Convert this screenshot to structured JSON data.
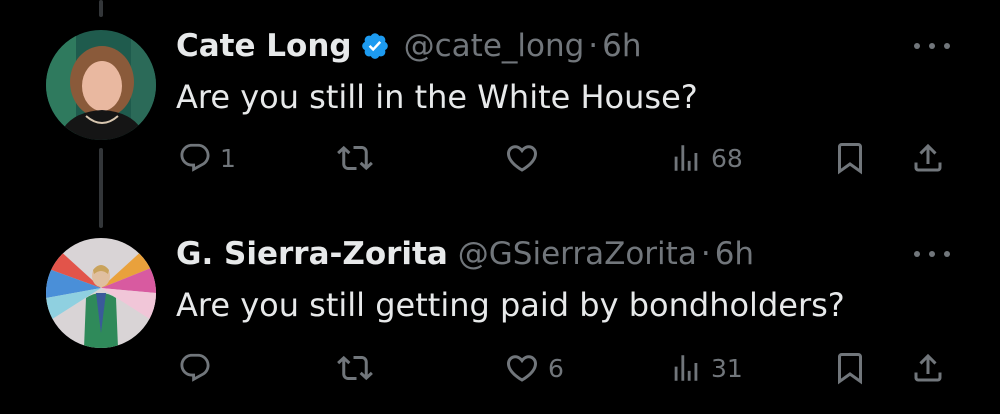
{
  "tweets": [
    {
      "name": "Cate Long",
      "verified": true,
      "handle": "@cate_long",
      "separator": "·",
      "time": "6h",
      "text": "Are you still in the White House?",
      "reply_count": "1",
      "retweet_count": "",
      "like_count": "",
      "view_count": "68",
      "avatar_icon": "avatar-photo"
    },
    {
      "name": "G. Sierra-Zorita",
      "verified": false,
      "handle": "@GSierraZorita",
      "separator": "·",
      "time": "6h",
      "text": "Are you still getting paid by bondholders?",
      "reply_count": "",
      "retweet_count": "",
      "like_count": "6",
      "view_count": "31",
      "avatar_icon": "avatar-photo"
    }
  ],
  "colors": {
    "background": "#000000",
    "text_primary": "#e7e9ea",
    "text_secondary": "#71767b",
    "verified_blue": "#1d9bf0",
    "thread_line": "#333639"
  }
}
